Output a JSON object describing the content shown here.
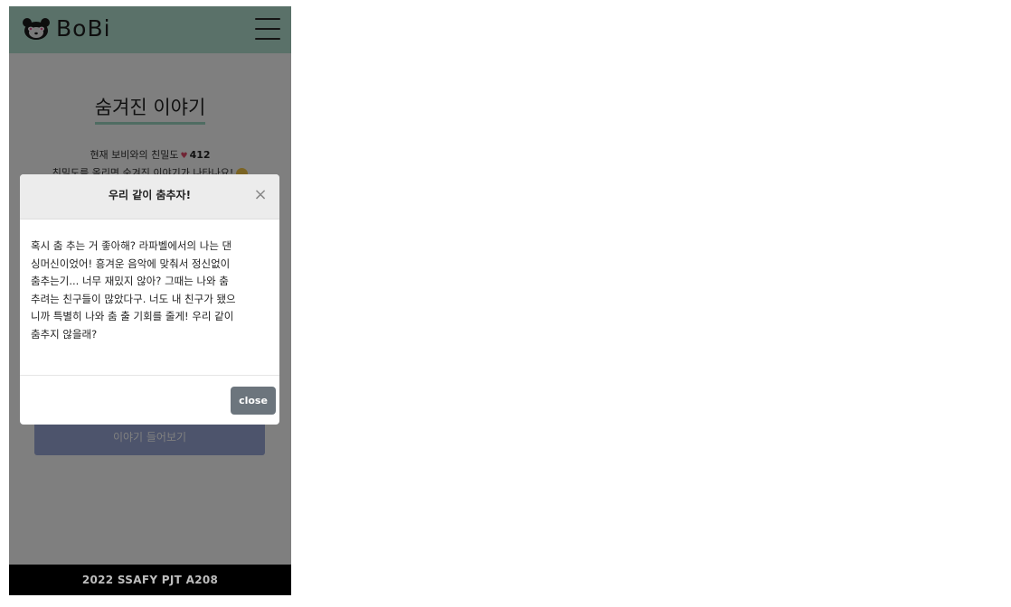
{
  "app": {
    "brand": "BoBi"
  },
  "page": {
    "title": "숨겨진 이야기",
    "intimacy_prefix": "현재 보비와의 친밀도",
    "intimacy_score": "412",
    "intimacy_hint": "친밀도를 올리면 숨겨진 이야기가 나타나요!",
    "story_button_label": "이야기 들어보기"
  },
  "modal": {
    "title": "우리 같이 춤추자!",
    "close_x": "×",
    "lines": [
      "혹시 춤 추는 거 좋아해? 라파벨에서의 나는 댄",
      "싱머신이었어! 흥겨운 음악에 맞춰서 정신없이",
      "춤추는기... 너무 재밌지 않아? 그때는 나와 춤",
      "추려는 친구들이 많았다구. 너도 내 친구가 됐으",
      "니까 특별히 나와 춤 출 기회를 줄게! 우리 같이",
      "춤추지 않을래?"
    ],
    "close_button": "close"
  },
  "footer": {
    "text": "2022 SSAFY PJT A208"
  },
  "colors": {
    "navbar": "#b5e3d3",
    "title_underline": "#9fd8c4",
    "button": "#9aa9d9",
    "close_button": "#6c757d",
    "footer": "#000000"
  },
  "icons": {
    "logo": "panda-icon",
    "menu": "hamburger-icon",
    "heart": "heart-icon",
    "emoji": "smile-emoji-icon"
  }
}
